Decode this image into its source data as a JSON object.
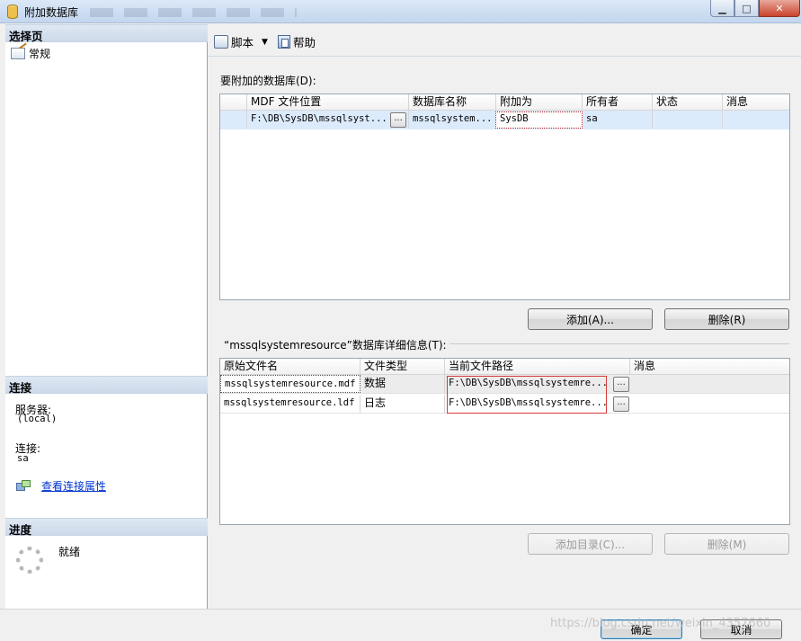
{
  "window": {
    "title": "附加数据库",
    "controls": {
      "minimize": "▁",
      "maximize": "□",
      "close": "✕"
    }
  },
  "left_panel": {
    "select_page_header": "选择页",
    "pages": [
      {
        "label": "常规",
        "icon": "properties-page-icon"
      }
    ],
    "connection_header": "连接",
    "server_label": "服务器:",
    "server_value": "(local)",
    "connection_label": "连接:",
    "connection_value": "sa",
    "view_connection_link": "查看连接属性",
    "progress_header": "进度",
    "progress_status": "就绪"
  },
  "toolbar": {
    "script_label": "脚本",
    "help_label": "帮助"
  },
  "attach_section": {
    "label": "要附加的数据库(D):",
    "columns": [
      "MDF 文件位置",
      "数据库名称",
      "附加为",
      "所有者",
      "状态",
      "消息"
    ],
    "rows": [
      {
        "mdf_location": "F:\\DB\\SysDB\\mssqlsyst...",
        "db_name": "mssqlsystem...",
        "attach_as": "SysDB",
        "owner": "sa",
        "status": "",
        "message": ""
      }
    ],
    "browse_label": "...",
    "add_button": "添加(A)...",
    "remove_button": "删除(R)"
  },
  "details_section": {
    "label": "“mssqlsystemresource”数据库详细信息(T):",
    "columns": [
      "原始文件名",
      "文件类型",
      "当前文件路径",
      "消息"
    ],
    "rows": [
      {
        "original_name": "mssqlsystemresource.mdf",
        "file_type": "数据",
        "current_path": "F:\\DB\\SysDB\\mssqlsystemre...",
        "message": ""
      },
      {
        "original_name": "mssqlsystemresource.ldf",
        "file_type": "日志",
        "current_path": "F:\\DB\\SysDB\\mssqlsystemre...",
        "message": ""
      }
    ],
    "browse_label": "...",
    "add_catalog_button": "添加目录(C)...",
    "remove_button": "删除(M)"
  },
  "footer": {
    "ok_button": "确定",
    "cancel_button": "取消",
    "watermark": "https://blog.csdn.net/weixin_4357660"
  },
  "colors": {
    "accent_blue": "#0033cc",
    "selection": "#dcebfb",
    "highlight_red": "#d93a3a"
  }
}
